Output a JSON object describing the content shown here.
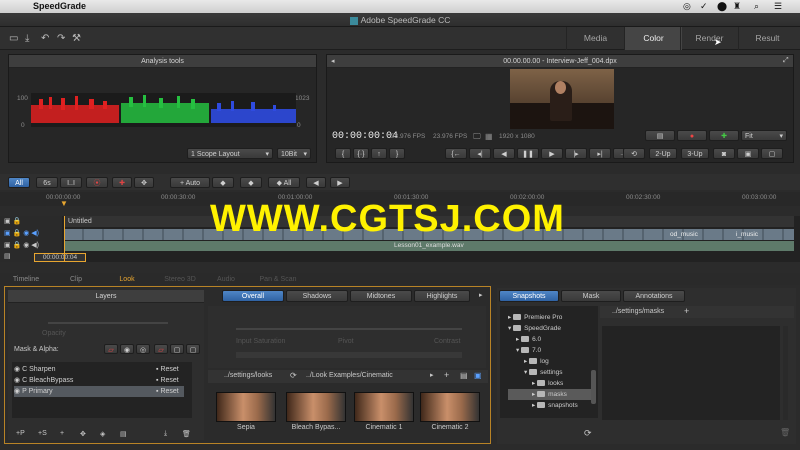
{
  "menubar": {
    "app": "SpeedGrade"
  },
  "window": {
    "title": "Adobe SpeedGrade CC"
  },
  "top_tabs": [
    "Media",
    "Color",
    "Render",
    "Result"
  ],
  "analysis": {
    "title": "Analysis tools",
    "scale_top": "100",
    "scale_bottom": "0",
    "scale_top_r": "1023",
    "scale_bottom_r": "0",
    "layout": "1 Scope Layout",
    "bitdepth": "10Bit"
  },
  "viewer": {
    "title": "00.00.00.00 - Interview-Jeff_004.dpx",
    "timecode": "00:00:00:04",
    "fps1": "23.976 FPS",
    "fps2": "23.976 FPS",
    "resolution": "1920 x 1080",
    "fit": "Fit",
    "btn_2up": "2-Up",
    "btn_3up": "3-Up"
  },
  "timeline_toolbar": {
    "all": "All",
    "six": "6s",
    "ii": "I..I",
    "auto": "Auto",
    "all2": "All"
  },
  "ruler": [
    "00:00:00:00",
    "00:00:30:00",
    "00:01:00:00",
    "00:01:30:00",
    "00:02:00:00",
    "00:02:30:00",
    "00:03:00:00"
  ],
  "tracks": {
    "untitled": "Untitled",
    "clip_name": "od_music",
    "clip_name2": "i_music",
    "audio_name": "Lesson01_example.wav",
    "tc": "00:00:00:04"
  },
  "watermark": "WWW.CGTSJ.COM",
  "panel_tabs": [
    "Timeline",
    "Clip",
    "Look",
    "Stereo 3D",
    "Audio",
    "Pan & Scan"
  ],
  "layers": {
    "title": "Layers",
    "opacity": "Opacity",
    "mask_alpha": "Mask & Alpha:",
    "rows": [
      {
        "type": "C",
        "name": "Sharpen",
        "reset": "Reset"
      },
      {
        "type": "C",
        "name": "BleachBypass",
        "reset": "Reset"
      },
      {
        "type": "P",
        "name": "Primary",
        "reset": "Reset"
      }
    ],
    "bottom": [
      "+P",
      "+S",
      "+"
    ]
  },
  "tonal_tabs": [
    "Overall",
    "Shadows",
    "Midtones",
    "Highlights"
  ],
  "tonal_labels": [
    "Input Saturation",
    "Pivot",
    "Contrast"
  ],
  "looks": {
    "path1": "../settings/looks",
    "path2": "../Look Examples/Cinematic",
    "items": [
      "Sepia",
      "Bleach Bypas...",
      "Cinematic 1",
      "Cinematic 2"
    ]
  },
  "right_tabs": [
    "Snapshots",
    "Mask",
    "Annotations"
  ],
  "tree": [
    {
      "label": "Premiere Pro",
      "depth": 0
    },
    {
      "label": "SpeedGrade",
      "depth": 0
    },
    {
      "label": "6.0",
      "depth": 1
    },
    {
      "label": "7.0",
      "depth": 1
    },
    {
      "label": "log",
      "depth": 2
    },
    {
      "label": "settings",
      "depth": 2
    },
    {
      "label": "looks",
      "depth": 3
    },
    {
      "label": "masks",
      "depth": 3
    },
    {
      "label": "snapshots",
      "depth": 3
    }
  ],
  "masks_path": "../settings/masks",
  "colors": {
    "accent": "#e8a630",
    "blue": "#3f77bd",
    "watermark": "#fff200",
    "selected": "#54595f"
  }
}
